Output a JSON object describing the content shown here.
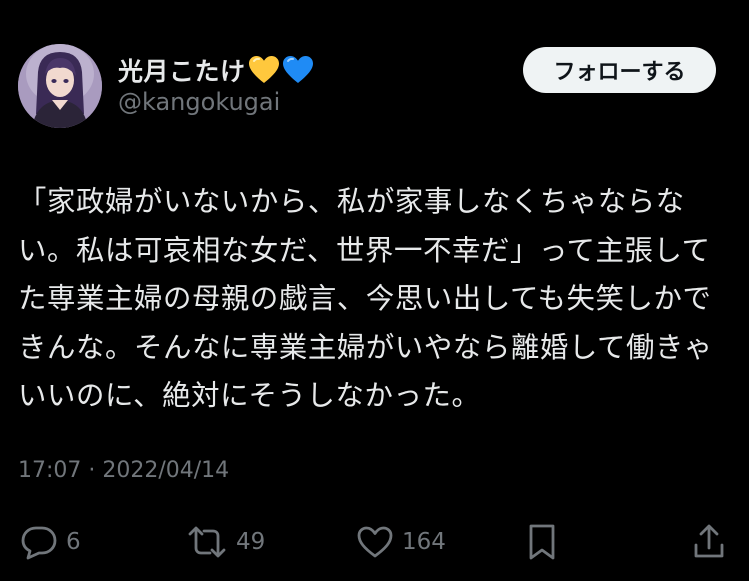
{
  "user": {
    "display_name": "光月こたけ",
    "handle": "@kangokugai",
    "name_emojis": [
      "yellow-heart",
      "blue-heart"
    ]
  },
  "follow_button": {
    "label": "フォローする"
  },
  "tweet": {
    "text": "「家政婦がいないから、私が家事しなくちゃならない。私は可哀相な女だ、世界一不幸だ」って主張してた専業主婦の母親の戯言、今思い出しても失笑しかできんな。そんなに専業主婦がいやなら離婚して働きゃいいのに、絶対にそうしなかった。",
    "timestamp": "17:07 · 2022/04/14"
  },
  "actions": {
    "replies": "6",
    "retweets": "49",
    "likes": "164"
  },
  "colors": {
    "background": "#000000",
    "text": "#e7e9ea",
    "secondary": "#71767b",
    "button_bg": "#eff3f4",
    "yellow_heart": "#ffc83d",
    "blue_heart": "#1f8bf5"
  }
}
